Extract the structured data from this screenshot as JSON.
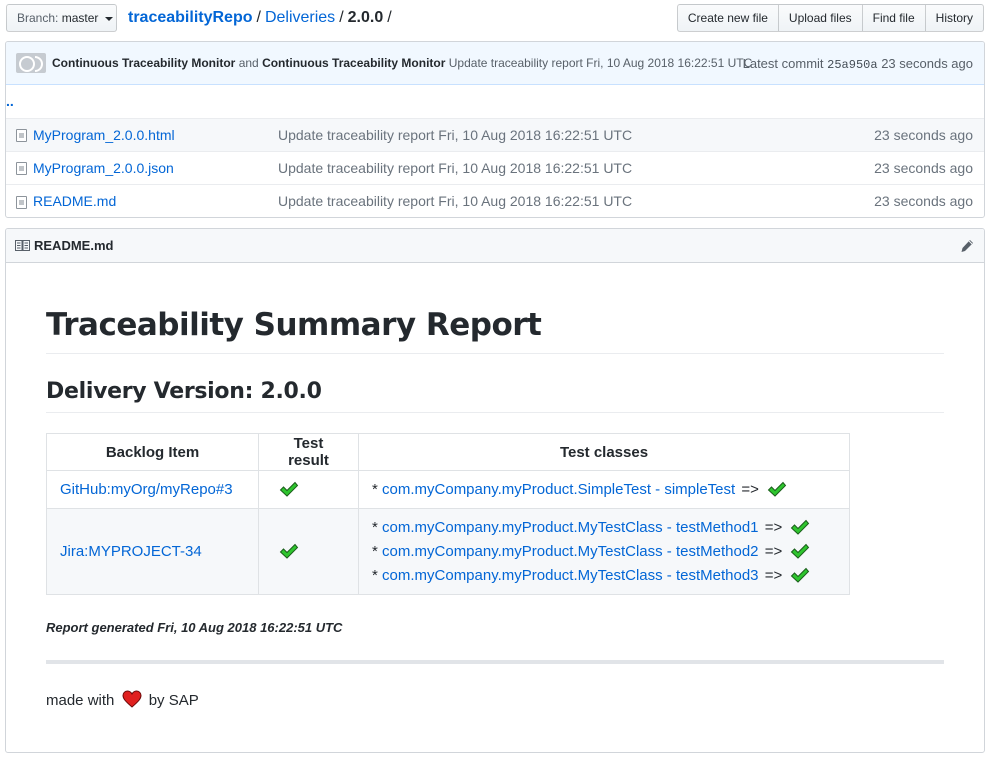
{
  "branch": {
    "label": "Branch:",
    "value": "master"
  },
  "breadcrumb": {
    "repo": "traceabilityRepo",
    "folder": "Deliveries",
    "current": "2.0.0",
    "separator": "/"
  },
  "actions": [
    "Create new file",
    "Upload files",
    "Find file",
    "History"
  ],
  "commit": {
    "author1": "Continuous Traceability Monitor",
    "conjunction": "and",
    "author2": "Continuous Traceability Monitor",
    "message": "Update traceability report Fri, 10 Aug 2018 16:22:51 UTC",
    "latest_label": "Latest commit",
    "sha": "25a950a",
    "age": "23 seconds ago"
  },
  "files": {
    "updir": "..",
    "items": [
      {
        "name": "MyProgram_2.0.0.html",
        "message": "Update traceability report Fri, 10 Aug 2018 16:22:51 UTC",
        "age": "23 seconds ago"
      },
      {
        "name": "MyProgram_2.0.0.json",
        "message": "Update traceability report Fri, 10 Aug 2018 16:22:51 UTC",
        "age": "23 seconds ago"
      },
      {
        "name": "README.md",
        "message": "Update traceability report Fri, 10 Aug 2018 16:22:51 UTC",
        "age": "23 seconds ago"
      }
    ]
  },
  "readme": {
    "filename": "README.md",
    "title": "Traceability Summary Report",
    "subtitle": "Delivery Version: 2.0.0",
    "table": {
      "headers": [
        "Backlog Item",
        "Test result",
        "Test classes"
      ],
      "rows": [
        {
          "backlog": "GitHub:myOrg/myRepo#3",
          "result": "passed",
          "tests": [
            {
              "name": "com.myCompany.myProduct.SimpleTest - simpleTest",
              "result": "passed"
            }
          ]
        },
        {
          "backlog": "Jira:MYPROJECT-34",
          "result": "passed",
          "tests": [
            {
              "name": "com.myCompany.myProduct.MyTestClass - testMethod1",
              "result": "passed"
            },
            {
              "name": "com.myCompany.myProduct.MyTestClass - testMethod2",
              "result": "passed"
            },
            {
              "name": "com.myCompany.myProduct.MyTestClass - testMethod3",
              "result": "passed"
            }
          ]
        }
      ],
      "bullet": "*",
      "arrow": "=>"
    },
    "generated": "Report generated Fri, 10 Aug 2018 16:22:51 UTC",
    "footer_before": "made with",
    "footer_after": "by SAP"
  },
  "colors": {
    "link": "#0366d6",
    "check": "#2ec52e",
    "heart": "#e0201f"
  }
}
